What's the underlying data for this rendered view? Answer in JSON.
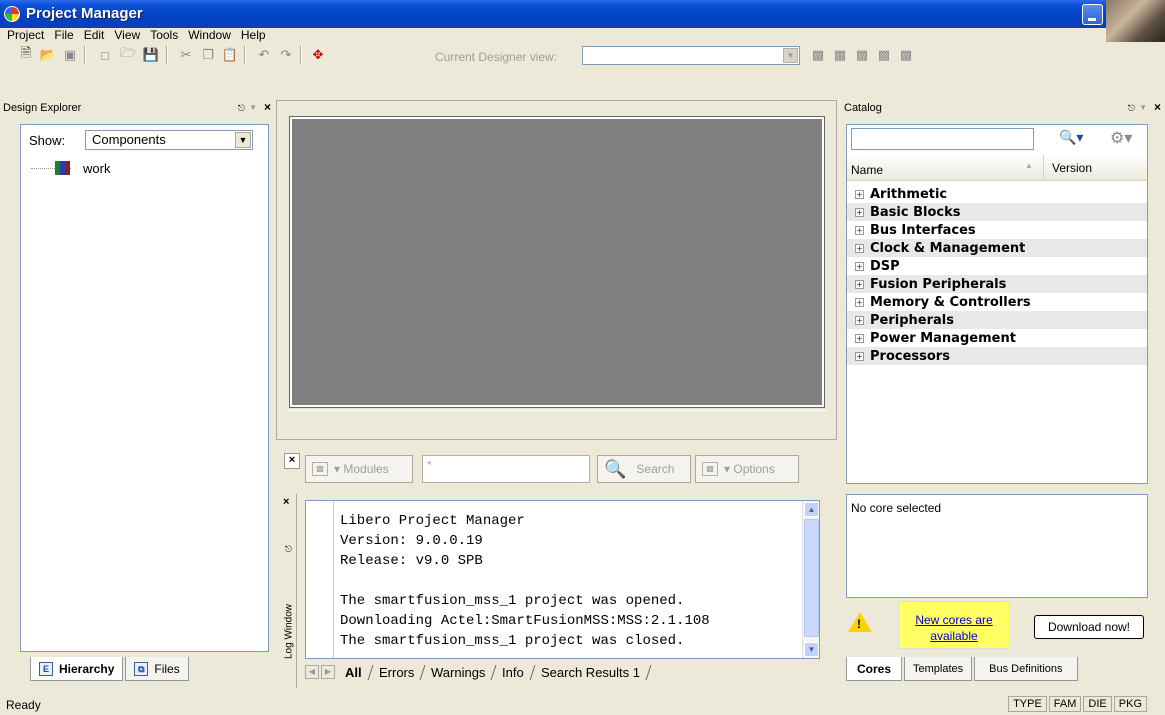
{
  "window": {
    "title": "Project Manager"
  },
  "menu": [
    "Project",
    "File",
    "Edit",
    "View",
    "Tools",
    "Window",
    "Help"
  ],
  "toolbar": {
    "current_view_label": "Current Designer view:",
    "current_view_value": ""
  },
  "design_explorer": {
    "title": "Design Explorer",
    "show_label": "Show:",
    "show_value": "Components",
    "tree": [
      {
        "label": "work"
      }
    ],
    "tabs": [
      "Hierarchy",
      "Files"
    ]
  },
  "modules_bar": {
    "modules_label": "Modules",
    "search_placeholder": "*",
    "search_label": "Search",
    "options_label": "Options"
  },
  "log": {
    "title": "Log Window",
    "lines": [
      "Libero Project Manager",
      "Version: 9.0.0.19",
      "Release: v9.0 SPB",
      "",
      "The smartfusion_mss_1 project was opened.",
      "Downloading Actel:SmartFusionMSS:MSS:2.1.108",
      "The smartfusion_mss_1 project was closed."
    ],
    "tabs": [
      "All",
      "Errors",
      "Warnings",
      "Info",
      "Search Results 1"
    ]
  },
  "catalog": {
    "title": "Catalog",
    "col_name": "Name",
    "col_version": "Version",
    "items": [
      "Arithmetic",
      "Basic Blocks",
      "Bus Interfaces",
      "Clock & Management",
      "DSP",
      "Fusion Peripherals",
      "Memory & Controllers",
      "Peripherals",
      "Power Management",
      "Processors"
    ],
    "detail": "No core selected",
    "new_cores": "New cores are available",
    "download_label": "Download now!",
    "tabs": [
      "Cores",
      "Templates",
      "Bus Definitions"
    ]
  },
  "status": {
    "text": "Ready",
    "cells": [
      "TYPE",
      "FAM",
      "DIE",
      "PKG"
    ]
  }
}
